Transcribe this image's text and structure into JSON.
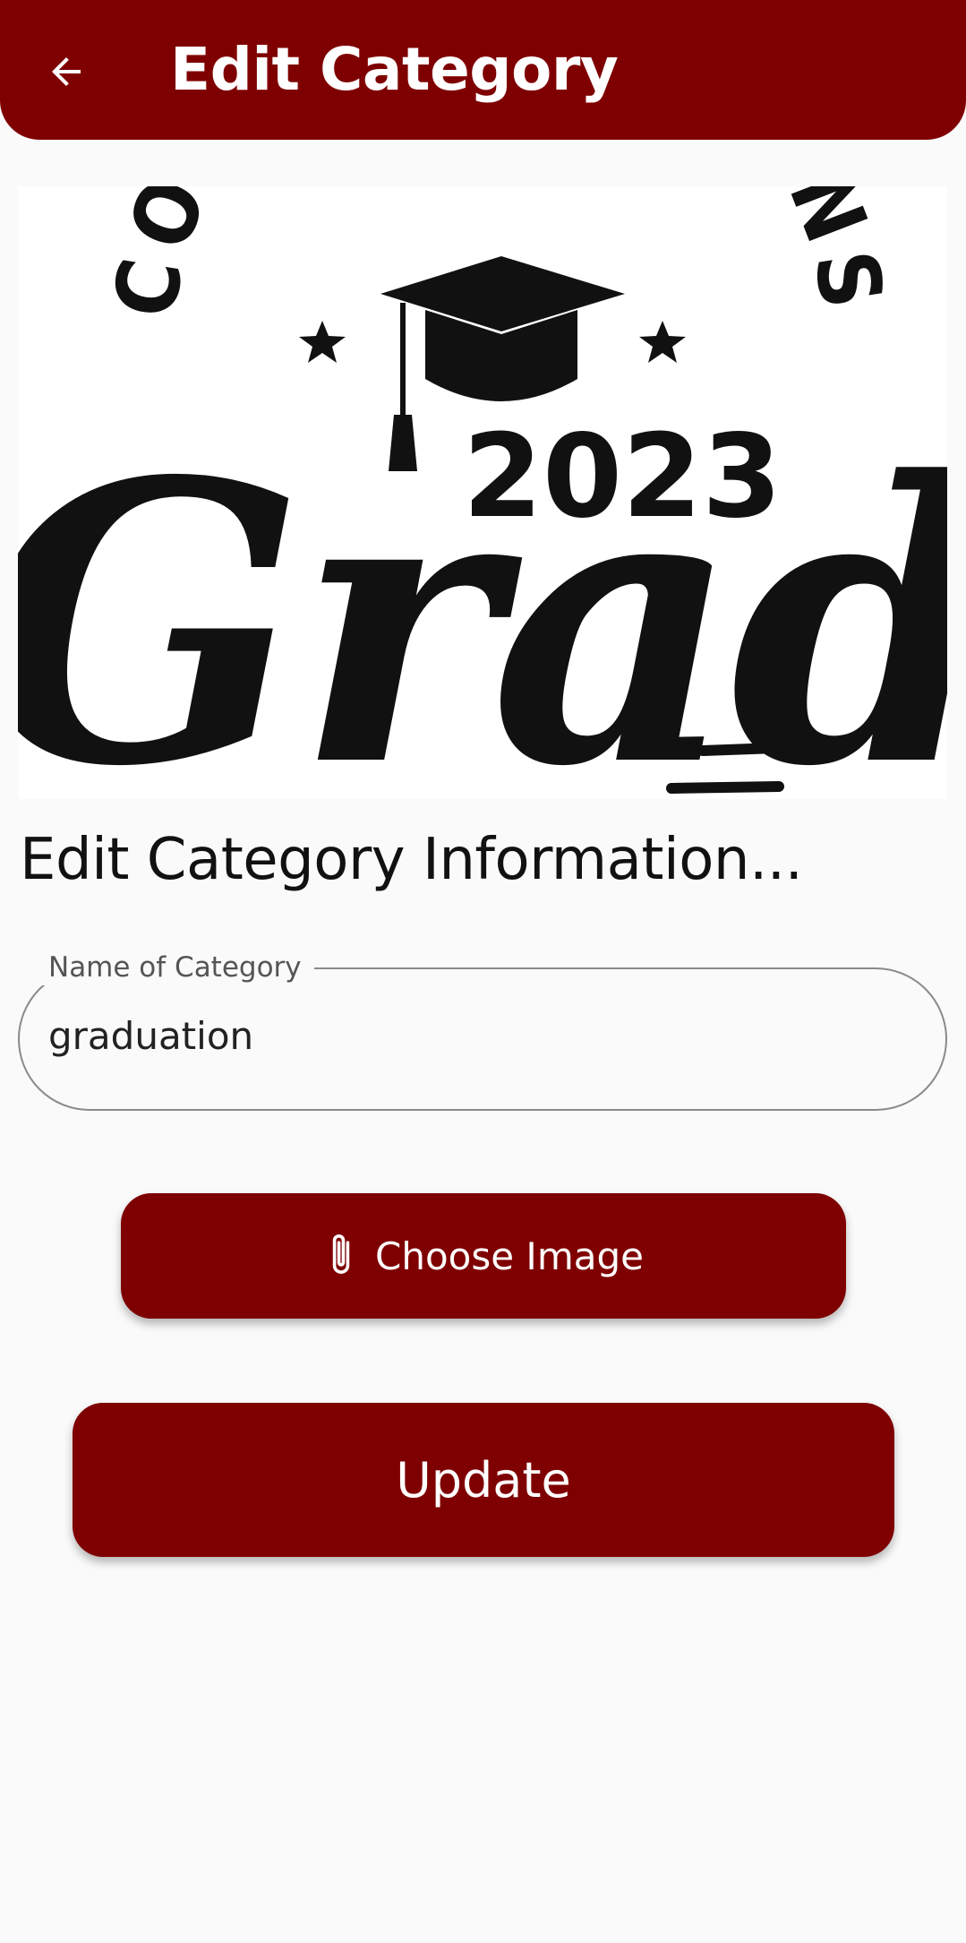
{
  "appbar": {
    "title": "Edit Category",
    "back_icon": "arrow-left-icon",
    "color": "#7f0000"
  },
  "image": {
    "arc_text": "CONGRATULATIONS",
    "year": "2023",
    "word": "Grad"
  },
  "form": {
    "heading": "Edit Category Information...",
    "name_label": "Name of Category",
    "name_value": "graduation"
  },
  "buttons": {
    "choose_image_label": "Choose Image",
    "choose_image_icon": "paperclip-icon",
    "update_label": "Update",
    "color": "#7f0000"
  }
}
